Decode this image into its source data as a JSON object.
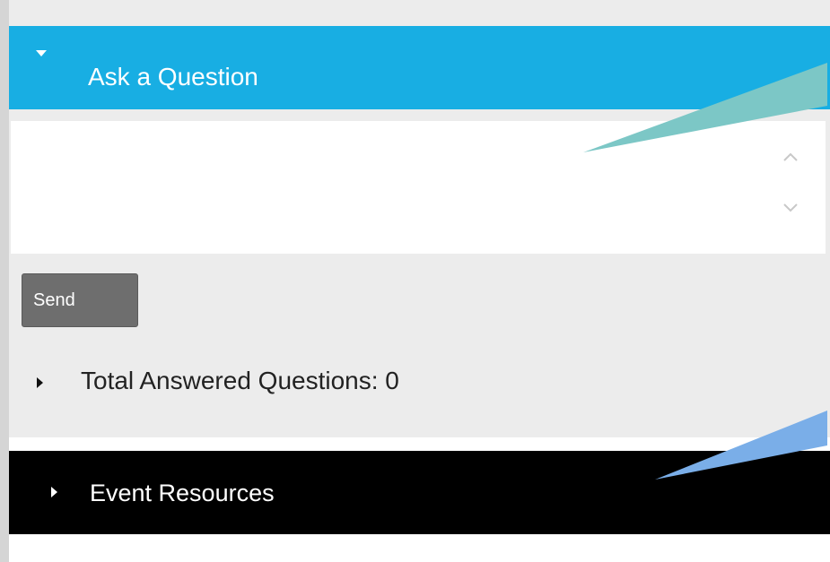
{
  "ask_section": {
    "title": "Ask a Question",
    "caret_icon": "caret-down-icon",
    "question_input": {
      "value": "",
      "placeholder": ""
    },
    "scroll_up_icon": "chevron-up-icon",
    "scroll_down_icon": "chevron-down-icon",
    "send_label": "Send"
  },
  "answered": {
    "label": "Total Answered Questions: 0",
    "caret_icon": "caret-right-icon"
  },
  "resources_section": {
    "title": "Event Resources",
    "caret_icon": "caret-right-icon"
  },
  "colors": {
    "ask_header": "#18aee3",
    "resources_header": "#000000",
    "panel_background": "#ececec",
    "send_button": "#6e6e6e",
    "callout_top": "#7cc7c6",
    "callout_bottom": "#7aaee8"
  }
}
